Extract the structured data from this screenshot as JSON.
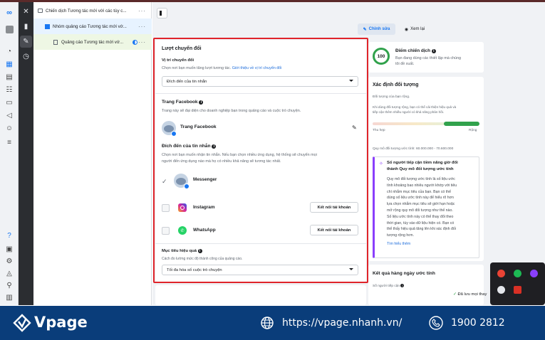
{
  "tree": {
    "campaign": "Chiến dịch Tương tác mới với các tùy c...",
    "adset": "Nhóm quảng cáo Tương tác mới vớ...",
    "ad": "Quảng cáo Tương tác mới vớ..."
  },
  "toolbar": {
    "edit": "Chỉnh sửa",
    "preview": "Xem lại"
  },
  "conversion": {
    "title": "Lượt chuyển đổi",
    "location_title": "Vị trí chuyển đổi",
    "location_desc": "Chọn nơi bạn muốn tăng lượt tương tác.",
    "location_link": "Giới thiệu về vị trí chuyển đổi",
    "location_value": "Đích đến của tin nhắn"
  },
  "facebook_page": {
    "title": "Trang Facebook",
    "desc": "Trang này sẽ đại diện cho doanh nghiệp bạn trong quảng cáo và cuộc trò chuyện.",
    "name": "Trang Facebook"
  },
  "destination": {
    "title": "Đích đến của tin nhắn",
    "desc1": "Chọn nơi bạn muốn nhận tin nhắn. Nếu bạn chọn nhiều ứng dụng, hệ thống sẽ chuyển mọi",
    "desc2": "người đến ứng dụng nào mà họ có nhiều khả năng sẽ tương tác nhất.",
    "apps": [
      {
        "name": "Messenger",
        "checked": true,
        "button": ""
      },
      {
        "name": "Instagram",
        "checked": false,
        "button": "Kết nối tài khoản"
      },
      {
        "name": "WhatsApp",
        "checked": false,
        "button": "Kết nối tài khoản"
      }
    ]
  },
  "performance": {
    "title": "Mục tiêu hiệu quả",
    "desc": "Cách đo lường mức độ thành công của quảng cáo.",
    "value": "Tối đa hóa số cuộc trò chuyện"
  },
  "score": {
    "value": "100",
    "title": "Điểm chiến dịch",
    "desc1": "Bạn đang dùng các thiết lập mà chúng",
    "desc2": "tôi đề xuất."
  },
  "audience": {
    "title": "Xác định đối tượng",
    "subtitle": "Đối tượng của bạn rộng.",
    "desc1": "Khi dùng đối tượng rộng, bạn có thể cải thiện hiệu quả và",
    "desc2": "tiếp cận thêm nhiều người có khả năng phản hồi.",
    "narrow": "Thu hẹp",
    "broad": "Rộng",
    "size": "Quy mô đối tượng ước tính: 60.000.000 - 70.600.000",
    "info_title1": "Số người tiếp cận tiềm năng giờ đổi",
    "info_title2": "thành Quy mô đối tượng ước tính",
    "info_lines": [
      "Quy mô đối tượng ước tính là số liệu ước",
      "tính khoảng bao nhiêu người khớp với tiêu",
      "chí nhắm mục tiêu của bạn. Bạn có thể",
      "dùng số liệu ước tính này để hiểu rõ hơn",
      "lựa chọn nhắm mục tiêu sẽ giới hạn hoặc",
      "mở rộng quy mô đối tượng như thế nào.",
      "Số liệu ước tính này có thể thay đổi theo",
      "thời gian, tùy vào dữ liệu hiện có. Bạn có",
      "thể thấy hiệu quả tăng lên khi xác định đối",
      "tượng rộng hơn."
    ],
    "learn_more": "Tìm hiểu thêm"
  },
  "daily": {
    "title": "Kết quả hàng ngày ước tính",
    "sub": "Số người tiếp cận"
  },
  "status": {
    "text": "Đã lưu mọi thay"
  },
  "footer": {
    "brand": "Vpage",
    "url": "https://vpage.nhanh.vn/",
    "phone": "1900 2812"
  },
  "colors": {
    "accent": "#1877f2",
    "footer_bg": "#0a3d7a",
    "highlight": "#e0242a",
    "score_green": "#31a24c"
  }
}
